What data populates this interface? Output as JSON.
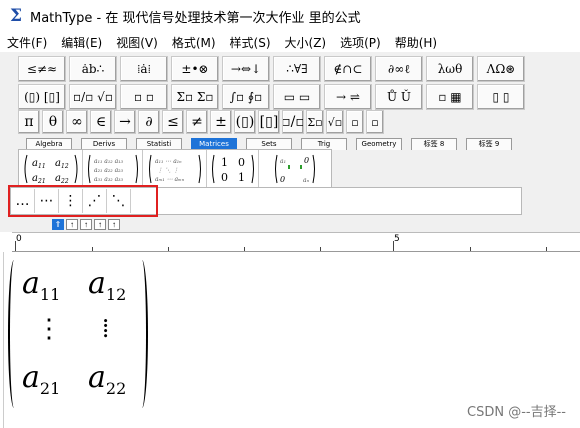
{
  "window": {
    "title": "MathType - 在 现代信号处理技术第一次大作业 里的公式",
    "icon": "sigma-icon"
  },
  "menu": [
    "文件(F)",
    "编辑(E)",
    "视图(V)",
    "格式(M)",
    "样式(S)",
    "大小(Z)",
    "选项(P)",
    "帮助(H)"
  ],
  "toolbar": {
    "row1": [
      "≤≠≈",
      "ȧb∴",
      "⁞ȧ⁞",
      "±•⊗",
      "→⇔↓",
      "∴∀∃",
      "∉∩⊂",
      "∂∞ℓ",
      "λωθ",
      "ΛΩ⊛"
    ],
    "row2": [
      "(▯) [▯]",
      "▫/▫ √▫",
      "▫ ▫",
      "Σ▫ Σ▫",
      "∫▫ ∮▫",
      "▭ ▭",
      "→ ⇌",
      "Ů Ǔ",
      "▫ ▦",
      "▯ ▯"
    ],
    "row3": [
      "π",
      "θ",
      "∞",
      "∈",
      "→",
      "∂",
      "≤",
      "≠",
      "±",
      "(▯)",
      "[▯]",
      "▫/▫",
      "Σ▫",
      "√▫",
      "▫",
      "▫"
    ],
    "tabs": [
      "Algebra",
      "Derivs",
      "Statisti",
      "Matrices",
      "Sets",
      "Trig",
      "Geometry",
      "标签 8",
      "标签 9"
    ],
    "active_tab": "Matrices",
    "dots": [
      "…",
      "⋯",
      "⋮",
      "⋰",
      "⋱"
    ],
    "mini_buttons": [
      "⇑",
      "↑",
      "↑",
      "↑",
      "↑"
    ]
  },
  "ruler": {
    "labels": [
      "0",
      "5"
    ]
  },
  "editor": {
    "cells": {
      "a11": "a",
      "a11_sub": "11",
      "a12": "a",
      "a12_sub": "12",
      "a21": "a",
      "a21_sub": "21",
      "a22": "a",
      "a22_sub": "22",
      "vdots_left": "⋮",
      "vdots_right": "⁞"
    }
  },
  "watermark": "CSDN @--吉择--"
}
